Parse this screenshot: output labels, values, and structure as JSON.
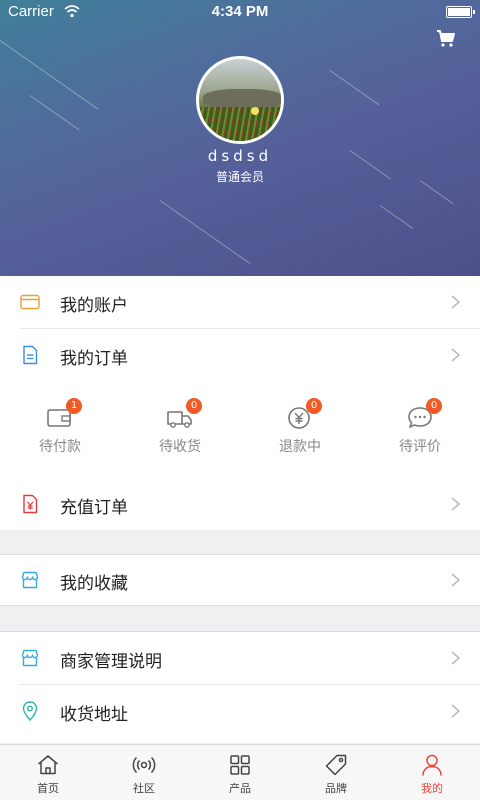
{
  "status_bar": {
    "carrier": "Carrier",
    "time": "4:34 PM"
  },
  "profile": {
    "username": "dsdsd",
    "member_level": "普通会员"
  },
  "menu": {
    "my_account": "我的账户",
    "my_orders": "我的订单",
    "recharge_orders": "充值订单",
    "my_favorites": "我的收藏",
    "merchant_guide": "商家管理说明",
    "shipping_address": "收货地址"
  },
  "order_status": [
    {
      "label": "待付款",
      "count": "1",
      "icon": "wallet-icon"
    },
    {
      "label": "待收货",
      "count": "0",
      "icon": "delivery-truck-icon"
    },
    {
      "label": "退款中",
      "count": "0",
      "icon": "refund-yen-icon"
    },
    {
      "label": "待评价",
      "count": "0",
      "icon": "comment-icon"
    }
  ],
  "tabs": [
    {
      "label": "首页",
      "icon": "home-icon"
    },
    {
      "label": "社区",
      "icon": "broadcast-icon"
    },
    {
      "label": "产品",
      "icon": "grid-icon"
    },
    {
      "label": "品牌",
      "icon": "tag-icon"
    },
    {
      "label": "我的",
      "icon": "person-icon",
      "active": true
    }
  ],
  "colors": {
    "accent": "#e8473a",
    "badge": "#f15a24",
    "header_start": "#3f7f99",
    "header_end": "#4e4f8a"
  }
}
